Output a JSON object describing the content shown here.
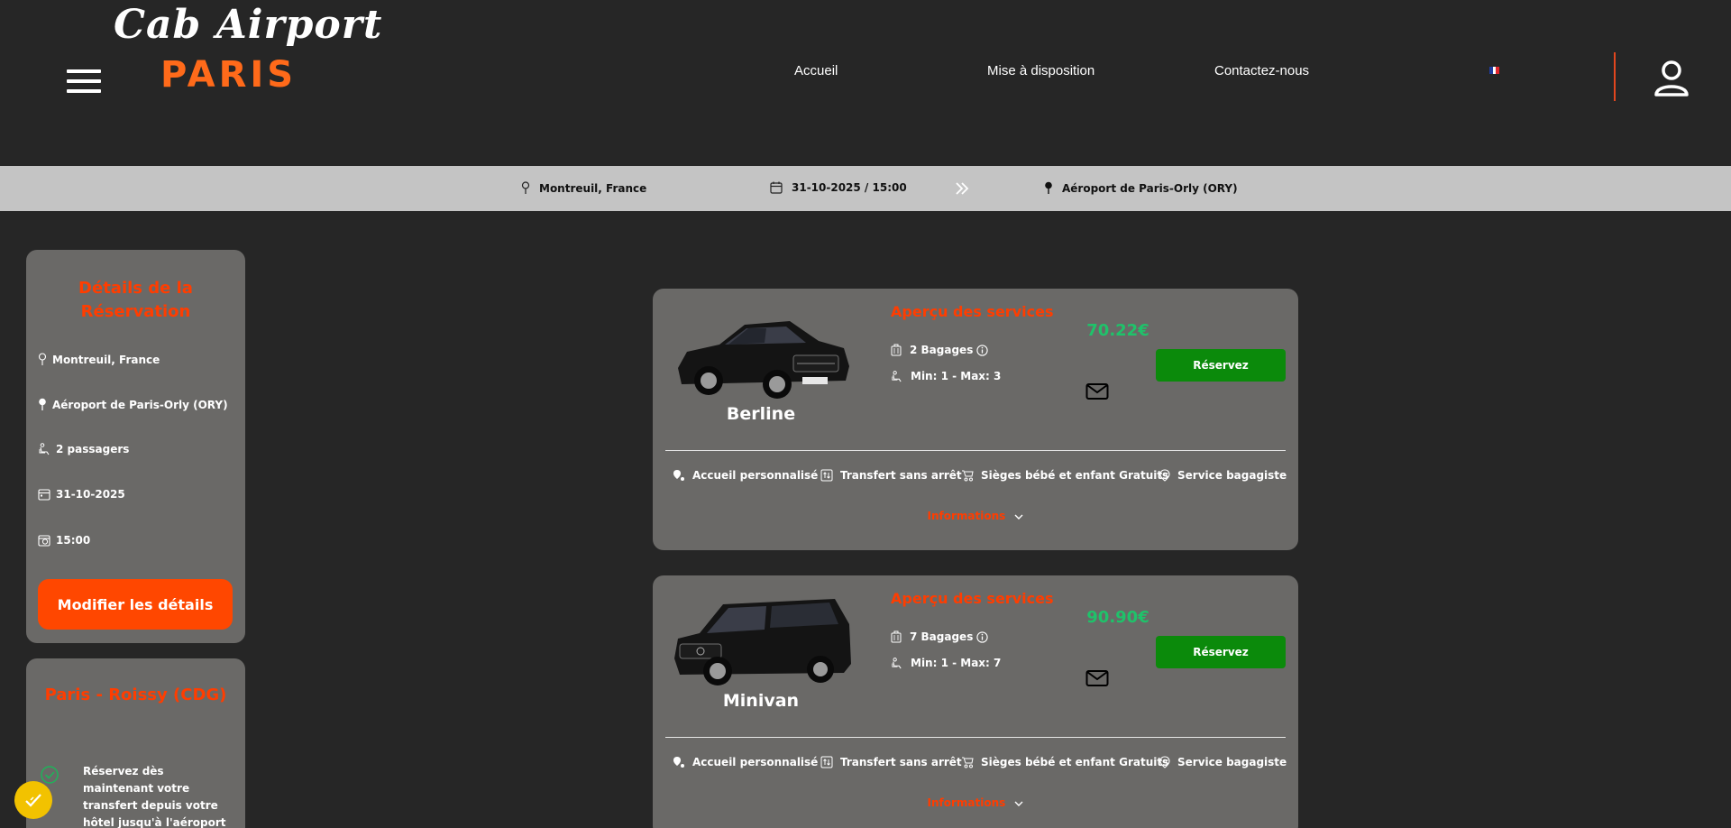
{
  "header": {
    "logo_script": "Cab Airport",
    "logo_city": "PARIS",
    "nav": [
      "Accueil",
      "Mise à disposition",
      "Contactez-nous"
    ],
    "language_flag": "fr",
    "icons": [
      "hamburger-menu-icon",
      "user-account-icon"
    ]
  },
  "search": {
    "from": "Montreuil, France",
    "datetime": "31-10-2025 / 15:00",
    "to": "Aéroport de Paris-Orly (ORY)"
  },
  "sidebar": {
    "details_title": "Détails de la Réservation",
    "from": "Montreuil, France",
    "to": "Aéroport de Paris-Orly (ORY)",
    "passengers": "2 passagers",
    "date": "31-10-2025",
    "time": "15:00",
    "modify_label": "Modifier les détails",
    "promo_title": "Paris - Roissy (CDG)",
    "promo_text": "Réservez dès maintenant votre transfert depuis votre hôtel jusqu'à l'aéroport de Paris-Charles de Gaulle"
  },
  "vehicles": [
    {
      "name": "Berline",
      "services_title": "Aperçu des services",
      "luggage": "2 Bagages",
      "passengers": "Min: 1 - Max: 3",
      "price": "70.22€",
      "book_label": "Réservez",
      "features": [
        "Accueil personnalisé",
        "Transfert sans arrêt",
        "Sièges bébé et enfant Gratuits",
        "Service bagagiste"
      ],
      "info_label": "Informations"
    },
    {
      "name": "Minivan",
      "services_title": "Aperçu des services",
      "luggage": "7 Bagages",
      "passengers": "Min: 1 - Max: 7",
      "price": "90.90€",
      "book_label": "Réservez",
      "features": [
        "Accueil personnalisé",
        "Transfert sans arrêt",
        "Sièges bébé et enfant Gratuits",
        "Service bagagiste"
      ],
      "info_label": "Informations"
    }
  ],
  "colors": {
    "background": "#262626",
    "card": "#6a6967",
    "accent": "#ff3d00",
    "price": "#1fc26a",
    "book_button": "#0b8a0b",
    "search_bar": "#c4c4c4"
  }
}
